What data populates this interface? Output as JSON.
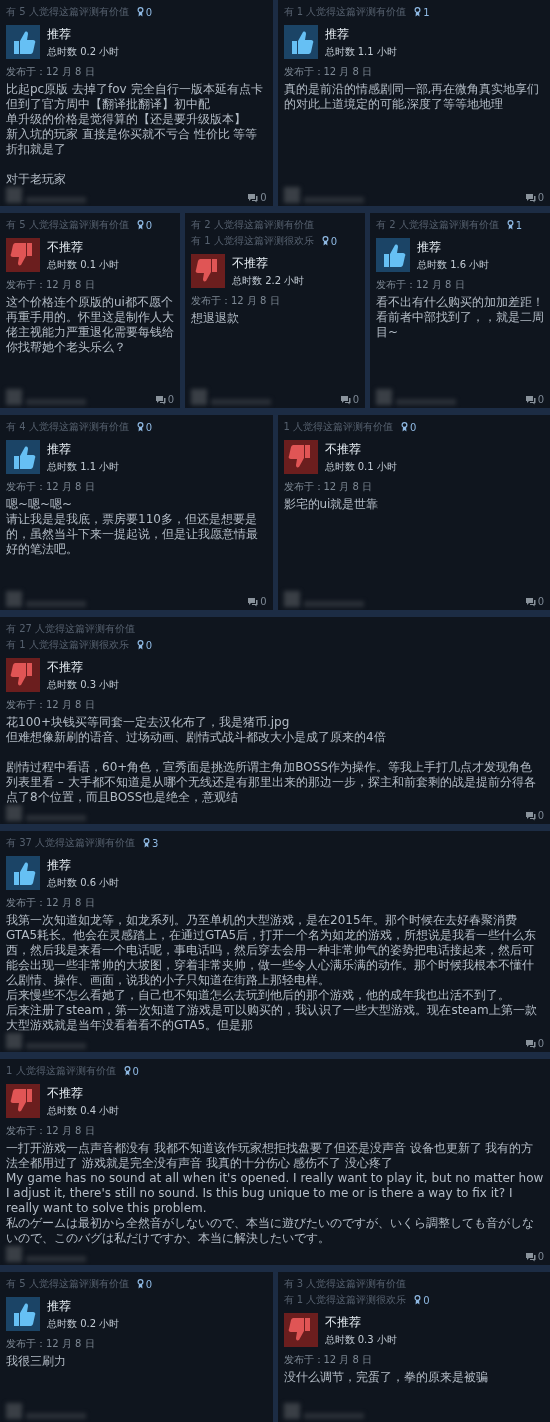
{
  "rows": [
    {
      "cards": [
        {
          "helpful": [
            "有 5 人觉得这篇评测有价值"
          ],
          "awards": "0",
          "verdict": {
            "kind": "recommended",
            "label": "推荐"
          },
          "hours": "总时数 0.2 小时",
          "posted": "发布于：12 月 8 日",
          "body": [
            [
              "比起pc原版 去掉了fov 完全自行一版本延有点卡",
              "但到了官方周中【翻译批翻译】初中配",
              "单升级的价格是觉得算的【还是要升级版本】",
              "新入坑的玩家 直接是你买就不亏合 性价比 等等折扣就是了"
            ],
            [
              "对于老玩家"
            ]
          ],
          "comments": "0"
        },
        {
          "helpful": [
            "有 1 人觉得这篇评测有价值"
          ],
          "awards": "1",
          "verdict": {
            "kind": "recommended",
            "label": "推荐"
          },
          "hours": "总时数 1.1 小时",
          "posted": "发布于：12 月 8 日",
          "body": [
            [
              "真的是前沿的情感剧同一部,再在微角真实地享们的对此上道境定的可能,深度了等等地地理"
            ]
          ],
          "comments": "0"
        }
      ]
    },
    {
      "cards": [
        {
          "helpful": [
            "有 5 人觉得这篇评测有价值"
          ],
          "awards": "0",
          "verdict": {
            "kind": "not_recommended",
            "label": "不推荐"
          },
          "hours": "总时数 0.1 小时",
          "posted": "发布于：12 月 8 日",
          "body": [
            [
              "这个价格连个原版的ui都不愿个再重手用的。怀里这是制作人大佬主视能力严重退化需要每钱给你找帮她个老头乐么？"
            ]
          ],
          "comments": "0"
        },
        {
          "helpful": [
            "有 2 人觉得这篇评测有价值",
            "有 1 人觉得这篇评测很欢乐"
          ],
          "awards": "0",
          "verdict": {
            "kind": "not_recommended",
            "label": "不推荐"
          },
          "hours": "总时数 2.2 小时",
          "posted": "发布于：12 月 8 日",
          "body": [
            [
              "想退退款"
            ]
          ],
          "comments": "0"
        },
        {
          "helpful": [
            "有 2 人觉得这篇评测有价值"
          ],
          "awards": "1",
          "verdict": {
            "kind": "recommended",
            "label": "推荐"
          },
          "hours": "总时数 1.6 小时",
          "posted": "发布于：12 月 8 日",
          "body": [
            [
              "看不出有什么购买的加加差距！看前者中部找到了，，就是二周目~"
            ]
          ],
          "comments": "0"
        }
      ]
    },
    {
      "cards": [
        {
          "helpful": [
            "有 4 人觉得这篇评测有价值"
          ],
          "awards": "0",
          "verdict": {
            "kind": "recommended",
            "label": "推荐"
          },
          "hours": "总时数 1.1 小时",
          "posted": "发布于：12 月 8 日",
          "body": [
            [
              "嗯~嗯~嗯~",
              "请让我是是我底，票房要110多，但还是想要是的，虽然当斗下来一提起说，但是让我愿意情最好的笔法吧。"
            ]
          ],
          "comments": "0"
        },
        {
          "helpful": [
            "1 人觉得这篇评测有价值"
          ],
          "awards": "0",
          "verdict": {
            "kind": "not_recommended",
            "label": "不推荐"
          },
          "hours": "总时数 0.1 小时",
          "posted": "发布于：12 月 8 日",
          "body": [
            [
              "影宅的ui就是世靠"
            ]
          ],
          "comments": "0"
        }
      ]
    },
    {
      "cards": [
        {
          "helpful": [
            "有 27 人觉得这篇评测有价值",
            "有 1 人觉得这篇评测很欢乐"
          ],
          "awards": "0",
          "verdict": {
            "kind": "not_recommended",
            "label": "不推荐"
          },
          "hours": "总时数 0.3 小时",
          "posted": "发布于：12 月 8 日",
          "body": [
            [
              "花100+块钱买等同套一定去汉化布了，我是猪币.jpg",
              "但难想像新刷的语音、过场动画、剧情式战斗都改大小是成了原来的4倍"
            ],
            [
              "剧情过程中看语，60+角色，宣秀面是挑选所谓主角加BOSS作为操作。等我上手打几点才发现角色列表里看 – 大手都不知道是从哪个无线还是有那里出来的那边一步，探主和前套剩的战是提前分得各点了8个位置，而且BOSS也是绝全，意观结"
            ]
          ],
          "comments": "0"
        }
      ]
    },
    {
      "cards": [
        {
          "helpful": [
            "有 37 人觉得这篇评测有价值"
          ],
          "awards": "3",
          "verdict": {
            "kind": "recommended",
            "label": "推荐"
          },
          "hours": "总时数 0.6 小时",
          "posted": "发布于：12 月 8 日",
          "body": [
            [
              "我第一次知道如龙等，如龙系列。乃至单机的大型游戏，是在2015年。那个时候在去好春聚消费GTA5耗长。他会在灵感踏上，在通过GTA5后，打开一个名为如龙的游戏，所想说是我看一些什么东西，然后我是来看一个电话呢，事电话吗，然后穿去会用一种非常帅气的姿势把电话接起来，然后可能会出现一些非常帅的大坡图，穿着非常夹帅，做一些令人心满乐满的动作。那个时候我根本不懂什么剧情、操作、画面，说我的小子只知道在街路上那轻电样。",
              "后来慢些不怎么看她了，自己也不知道怎么去玩到他后的那个游戏，他的成年我也出活不到了。",
              "后来注册了steam，第一次知道了游戏是可以购买的，我认识了一些大型游戏。现在steam上第一款大型游戏就是当年没看着看不的GTA5。但是那"
            ]
          ],
          "comments": "0"
        }
      ]
    },
    {
      "cards": [
        {
          "helpful": [
            "1 人觉得这篇评测有价值"
          ],
          "awards": "0",
          "verdict": {
            "kind": "not_recommended",
            "label": "不推荐"
          },
          "hours": "总时数 0.4 小时",
          "posted": "发布于：12 月 8 日",
          "body": [
            [
              "一打开游戏一点声音都没有 我都不知道该作玩家想拒找盘要了但还是没声音 设备也更新了 我有的方法全都用过了 游戏就是完全没有声音 我真的十分伤心 感伤不了 没心疼了",
              "My game has no sound at all when it's opened. I really want to play it, but no matter how I adjust it, there's still no sound. Is this bug unique to me or is there a way to fix it? I really want to solve this problem.",
              "私のゲームは最初から全然音がしないので、本当に遊びたいのですが、いくら調整しても音がしないので、このバグは私だけですか、本当に解決したいです。"
            ]
          ],
          "comments": "0"
        }
      ]
    },
    {
      "cards": [
        {
          "helpful": [
            "有 5 人觉得这篇评测有价值"
          ],
          "awards": "0",
          "verdict": {
            "kind": "recommended",
            "label": "推荐"
          },
          "hours": "总时数 0.2 小时",
          "posted": "发布于：12 月 8 日",
          "body": [
            [
              "我很三刷力"
            ]
          ]
        },
        {
          "helpful": [
            "有 3 人觉得这篇评测有价值",
            "有 1 人觉得这篇评测很欢乐"
          ],
          "awards": "0",
          "verdict": {
            "kind": "not_recommended",
            "label": "不推荐"
          },
          "hours": "总时数 0.3 小时",
          "posted": "发布于：12 月 8 日",
          "body": [
            [
              "没什么调节，完蛋了，拳的原来是被骗"
            ]
          ]
        }
      ]
    }
  ]
}
